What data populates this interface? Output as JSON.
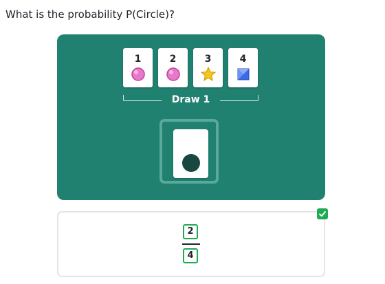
{
  "question": "What is the probability P(Circle)?",
  "cards": [
    {
      "number": "1",
      "shape": "pink-circle-icon"
    },
    {
      "number": "2",
      "shape": "pink-circle-icon"
    },
    {
      "number": "3",
      "shape": "gold-star-icon"
    },
    {
      "number": "4",
      "shape": "blue-square-icon"
    }
  ],
  "draw_label": "Draw 1",
  "drawn_card_shape": "dark-green-circle-icon",
  "answer": {
    "numerator": "2",
    "denominator": "4",
    "status": "correct"
  },
  "colors": {
    "panel": "#208170",
    "pink_circle": "#e879c9",
    "star": "#f5c518",
    "blue_square": "#3b6ce8",
    "drawn_circle": "#184840",
    "correct": "#1fab54"
  }
}
